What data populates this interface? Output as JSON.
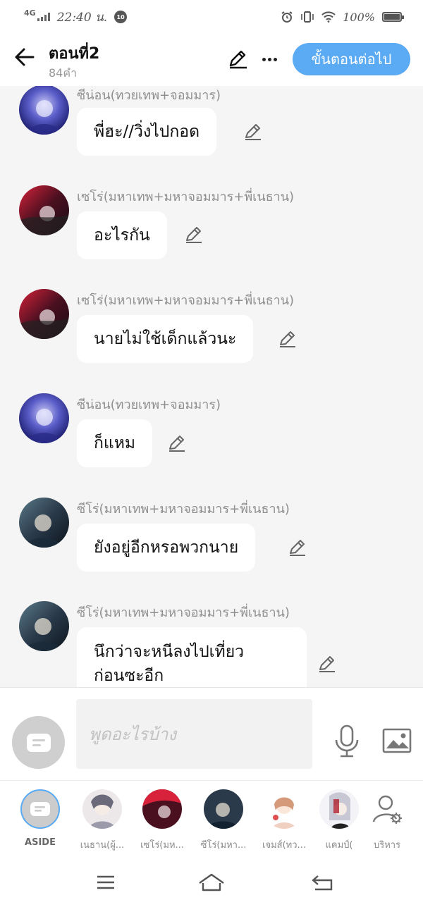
{
  "status_bar": {
    "network": "4G",
    "time": "22:40 น.",
    "notification_count": "10",
    "battery_percent": "100%"
  },
  "header": {
    "title": "ตอนที่2",
    "word_count": "84คำ",
    "next_button": "ขั้นตอนต่อไป"
  },
  "messages": [
    {
      "speaker": "ซีน่อน(ทวยเทพ+จอมมาร)",
      "text": "พี่ฮะ//วิ่งไปกอด",
      "avatar_color": "#5a5cc8"
    },
    {
      "speaker": "เซโร่(มหาเทพ+มหาจอมมาร+พี่เนธาน)",
      "text": "อะไรกัน",
      "avatar_color": "#6a1a2a"
    },
    {
      "speaker": "เซโร่(มหาเทพ+มหาจอมมาร+พี่เนธาน)",
      "text": "นายไม่ใช้เด็กแล้วนะ",
      "avatar_color": "#6a1a2a"
    },
    {
      "speaker": "ซีน่อน(ทวยเทพ+จอมมาร)",
      "text": "ก็แหม",
      "avatar_color": "#5a5cc8"
    },
    {
      "speaker": "ซีโร่(มหาเทพ+มหาจอมมาร+พี่เนธาน)",
      "text": "ยังอยู่อีกหรอพวกนาย",
      "avatar_color": "#2a3a4a"
    },
    {
      "speaker": "ซีโร่(มหาเทพ+มหาจอมมาร+พี่เนธาน)",
      "text_line1": "นึกว่าจะหนีลงไปเที่ยว",
      "text_line2": "ก่อนซะอีก",
      "avatar_color": "#2a3a4a"
    }
  ],
  "input": {
    "placeholder": "พูดอะไรบ้าง"
  },
  "characters": [
    {
      "name": "ASIDE"
    },
    {
      "name": "เนธาน(ผู้...",
      "avatar_color": "#d8d2d6"
    },
    {
      "name": "เซโร่(มห...",
      "avatar_color": "#6a1a2a"
    },
    {
      "name": "ซีโร่(มหา...",
      "avatar_color": "#2a3a4a"
    },
    {
      "name": "เจมส์(ทว...",
      "avatar_color": "#f3d9c8"
    },
    {
      "name": "แคมป์(",
      "avatar_color": "#e8e8ee"
    },
    {
      "name": "บริหาร"
    }
  ],
  "icons": {
    "back": "arrow-left-icon",
    "edit": "pencil-icon",
    "more": "more-dots-icon",
    "mic": "microphone-icon",
    "image": "image-icon",
    "manage": "user-settings-icon",
    "nav_menu": "menu-icon",
    "nav_home": "home-icon",
    "nav_back": "back-icon"
  },
  "colors": {
    "accent": "#5aaaf4",
    "background": "#f5f5f5",
    "bubble": "#ffffff"
  }
}
